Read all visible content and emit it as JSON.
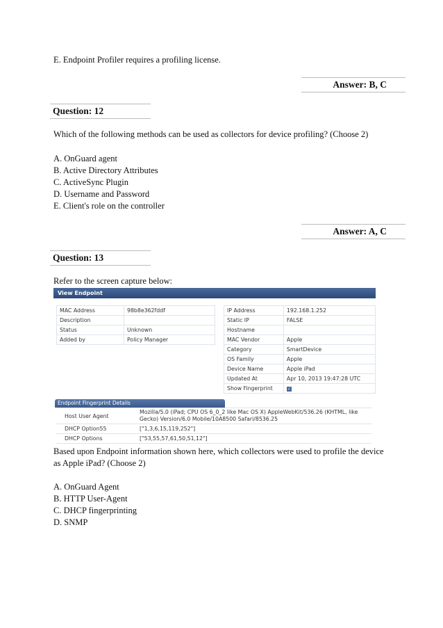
{
  "q11_tail": {
    "option_e": "E. Endpoint Profiler requires a profiling license.",
    "answer": "Answer: B, C"
  },
  "q12": {
    "title": "Question: 12",
    "prompt": "Which of the following methods can be used as collectors for device profiling? (Choose 2)",
    "options": [
      "A. OnGuard agent",
      "B. Active Directory Attributes",
      "C. ActiveSync Plugin",
      "D. Username and Password",
      "E. Client's role on the controller"
    ],
    "answer": "Answer: A, C"
  },
  "q13": {
    "title": "Question: 13",
    "intro": "Refer to the screen capture below:",
    "screenshot": {
      "header": "View Endpoint",
      "left_table": [
        {
          "key": "MAC Address",
          "value": "98b8e362fddf"
        },
        {
          "key": "Description",
          "value": ""
        },
        {
          "key": "Status",
          "value": "Unknown"
        },
        {
          "key": "Added by",
          "value": "Policy Manager"
        }
      ],
      "right_table": [
        {
          "key": "IP Address",
          "value": "192.168.1.252"
        },
        {
          "key": "Static IP",
          "value": "FALSE"
        },
        {
          "key": "Hostname",
          "value": ""
        },
        {
          "key": "MAC Vendor",
          "value": "Apple"
        },
        {
          "key": "Category",
          "value": "SmartDevice"
        },
        {
          "key": "OS Family",
          "value": "Apple"
        },
        {
          "key": "Device Name",
          "value": "Apple iPad"
        },
        {
          "key": "Updated At",
          "value": "Apr 10, 2013 19:47:28 UTC"
        },
        {
          "key": "Show Fingerprint",
          "value": "checked"
        }
      ],
      "fingerprint_header": "Endpoint Fingerprint Details",
      "fingerprint_table": [
        {
          "key": "Host User Agent",
          "value": "Mozilla/5.0 (iPad; CPU OS 6_0_2 like Mac OS X) AppleWebKit/536.26 (KHTML, like Gecko) Version/6.0 Mobile/10A8500 Safari/8536.25"
        },
        {
          "key": "DHCP Option55",
          "value": "[\"1,3,6,15,119,252\"]"
        },
        {
          "key": "DHCP Options",
          "value": "[\"53,55,57,61,50,51,12\"]"
        }
      ]
    },
    "prompt_line1": "Based upon Endpoint information shown here, which collectors were used to profile the device",
    "prompt_line2": "as Apple iPad? (Choose 2)",
    "options": [
      "A. OnGuard Agent",
      "B. HTTP User-Agent",
      "C. DHCP fingerprinting",
      "D. SNMP"
    ]
  }
}
